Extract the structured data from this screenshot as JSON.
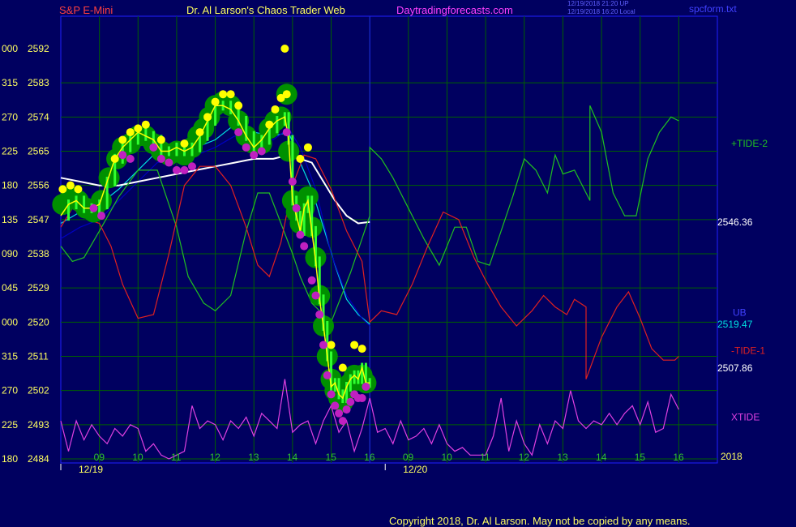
{
  "header": {
    "symbol": "S&P E-Mini",
    "author": "Dr. Al Larson's Chaos Trader Web",
    "site": "Daytradingforecasts.com",
    "stamp1": "12/19/2018 21:20 UP",
    "stamp2": "12/19/2018 16:20 Local",
    "filename": "spcform.txt"
  },
  "footer": {
    "copyright": "Copyright 2018, Dr. Al Larson. May not be copied by any means."
  },
  "colors": {
    "background": "#000060",
    "grid": "#006000",
    "frame": "#2020ff",
    "price": "#ffff00",
    "ub": "#00e0e0",
    "tide_plus": "#20c020",
    "tide_minus": "#e02020",
    "xtide": "#e040e0",
    "slow_avg": "#ffffff",
    "lb": "#0000c0",
    "ball_big": "#009000",
    "ball_yellow": "#ffff00",
    "ball_magenta": "#c020c0"
  },
  "chart_data": {
    "type": "line",
    "y_ticks": [
      {
        "left": "000",
        "value": "2592"
      },
      {
        "left": "315",
        "value": "2583"
      },
      {
        "left": "270",
        "value": "2574"
      },
      {
        "left": "225",
        "value": "2565"
      },
      {
        "left": "180",
        "value": "2556"
      },
      {
        "left": "135",
        "value": "2547"
      },
      {
        "left": "090",
        "value": "2538"
      },
      {
        "left": "045",
        "value": "2529"
      },
      {
        "left": "000",
        "value": "2520"
      },
      {
        "left": "315",
        "value": "2511"
      },
      {
        "left": "270",
        "value": "2502"
      },
      {
        "left": "225",
        "value": "2493"
      },
      {
        "left": "180",
        "value": "2484"
      }
    ],
    "ylim": [
      2484,
      2592
    ],
    "xlim": [
      8,
      25
    ],
    "x_ticks": [
      {
        "x": 9,
        "label": "09"
      },
      {
        "x": 10,
        "label": "10"
      },
      {
        "x": 11,
        "label": "11"
      },
      {
        "x": 12,
        "label": "12"
      },
      {
        "x": 13,
        "label": "13"
      },
      {
        "x": 14,
        "label": "14"
      },
      {
        "x": 15,
        "label": "15"
      },
      {
        "x": 16,
        "label": "16"
      },
      {
        "x": 17,
        "label": "09"
      },
      {
        "x": 18,
        "label": "10"
      },
      {
        "x": 19,
        "label": "11"
      },
      {
        "x": 20,
        "label": "12"
      },
      {
        "x": 21,
        "label": "13"
      },
      {
        "x": 22,
        "label": "14"
      },
      {
        "x": 23,
        "label": "15"
      },
      {
        "x": 24,
        "label": "16"
      }
    ],
    "date_labels": [
      {
        "x": 8,
        "label": "12/19"
      },
      {
        "x": 16.4,
        "label": "12/20"
      }
    ],
    "year_label": "2018",
    "day_divider_x": 16,
    "series": [
      {
        "name": "Price",
        "role": "price",
        "x": [
          8.0,
          8.2,
          8.4,
          8.6,
          8.8,
          9.0,
          9.2,
          9.4,
          9.6,
          9.8,
          10.0,
          10.2,
          10.4,
          10.6,
          10.8,
          11.0,
          11.2,
          11.4,
          11.6,
          11.8,
          12.0,
          12.2,
          12.4,
          12.6,
          12.8,
          13.0,
          13.2,
          13.4,
          13.6,
          13.8,
          13.9,
          14.0,
          14.1,
          14.2,
          14.3,
          14.4,
          14.5,
          14.6,
          14.7,
          14.8,
          14.9,
          15.0,
          15.1,
          15.2,
          15.3,
          15.4,
          15.5,
          15.6,
          15.7,
          15.8,
          15.9,
          16.0
        ],
        "y": [
          2548,
          2551,
          2552,
          2550,
          2550,
          2551,
          2557,
          2563,
          2566,
          2568,
          2570,
          2569,
          2568,
          2565,
          2565,
          2566,
          2565,
          2566,
          2569,
          2573,
          2577,
          2577,
          2576,
          2573,
          2569,
          2566,
          2568,
          2571,
          2573,
          2574,
          2568,
          2552,
          2548,
          2544,
          2550,
          2552,
          2544,
          2536,
          2526,
          2519,
          2511,
          2503,
          2504,
          2501,
          2500,
          2503,
          2505,
          2506,
          2505,
          2508,
          2504,
          2504
        ]
      },
      {
        "name": "UB",
        "role": "ub",
        "x": [
          8.0,
          8.5,
          9.0,
          9.5,
          10.0,
          10.5,
          11.0,
          11.5,
          12.0,
          12.5,
          13.0,
          13.5,
          13.9,
          14.2,
          14.5,
          14.8,
          15.1,
          15.4,
          15.7,
          16.0
        ],
        "y": [
          2546,
          2549,
          2551,
          2555,
          2560,
          2565,
          2565,
          2566,
          2568,
          2572,
          2570,
          2569,
          2570,
          2562,
          2555,
          2545,
          2535,
          2526,
          2522,
          2519.47
        ]
      },
      {
        "name": "LB",
        "role": "lb",
        "x": [
          8.0,
          8.5,
          9.0,
          9.5,
          10.0,
          10.5,
          11.0,
          11.5,
          12.0,
          12.5,
          13.0,
          13.5,
          13.9,
          14.2,
          14.6,
          15.0,
          15.4,
          15.8,
          16.0
        ],
        "y": [
          2542,
          2545,
          2547,
          2552,
          2557,
          2562,
          2563,
          2564,
          2566,
          2569,
          2568,
          2568,
          2571,
          2566,
          2555,
          2538,
          2527,
          2521,
          2519
        ]
      },
      {
        "name": "Slow average",
        "role": "slow",
        "x": [
          8.0,
          8.5,
          9.0,
          9.5,
          10.0,
          10.5,
          11.0,
          11.5,
          12.0,
          12.5,
          13.0,
          13.5,
          13.9,
          14.2,
          14.5,
          14.8,
          15.1,
          15.4,
          15.7,
          16.0
        ],
        "y": [
          2558,
          2557,
          2556,
          2556,
          2557,
          2558,
          2559,
          2560,
          2561,
          2562,
          2563,
          2563,
          2564,
          2563,
          2562,
          2557,
          2552,
          2548,
          2546,
          2546.36
        ]
      },
      {
        "name": "+TIDE-2",
        "role": "tide_plus",
        "x": [
          8.0,
          8.3,
          8.6,
          9.0,
          9.5,
          10.0,
          10.5,
          11.0,
          11.3,
          11.7,
          12.0,
          12.4,
          12.8,
          13.1,
          13.4,
          13.7,
          14.0,
          14.2,
          14.5,
          15.0,
          15.5,
          15.9,
          16.0,
          16.0,
          16.3,
          16.6,
          17.0,
          17.4,
          17.8,
          18.2,
          18.5,
          18.8,
          19.1,
          19.4,
          19.7,
          20.0,
          20.3,
          20.6,
          20.8,
          21.0,
          21.3,
          21.6,
          21.7,
          21.7,
          22.0,
          22.3,
          22.6,
          22.9,
          23.2,
          23.5,
          23.8,
          24.0
        ],
        "y": [
          2540,
          2536,
          2537,
          2544,
          2553,
          2560,
          2560,
          2545,
          2532,
          2525,
          2523,
          2527,
          2544,
          2554,
          2554,
          2546,
          2538,
          2532,
          2525,
          2520,
          2533,
          2545,
          2548,
          2566,
          2563,
          2558,
          2550,
          2542,
          2535,
          2545,
          2545,
          2536,
          2535,
          2544,
          2553,
          2563,
          2560,
          2554,
          2564,
          2559,
          2560,
          2554,
          2552,
          2577,
          2570,
          2554,
          2548,
          2548,
          2563,
          2570,
          2574,
          2573
        ]
      },
      {
        "name": "-TIDE-1",
        "role": "tide_minus",
        "x": [
          8.0,
          8.3,
          8.7,
          9.0,
          9.3,
          9.6,
          10.0,
          10.4,
          10.8,
          11.2,
          11.6,
          12.0,
          12.4,
          12.8,
          13.1,
          13.4,
          13.7,
          14.0,
          14.3,
          14.6,
          15.0,
          15.4,
          15.8,
          16.0,
          16.0,
          16.3,
          16.7,
          17.1,
          17.5,
          17.9,
          18.3,
          18.7,
          19.0,
          19.4,
          19.8,
          20.2,
          20.5,
          20.8,
          21.1,
          21.3,
          21.6,
          21.6,
          22.0,
          22.4,
          22.7,
          23.0,
          23.3,
          23.6,
          23.9,
          24.0
        ],
        "y": [
          2545,
          2550,
          2547,
          2546,
          2540,
          2530,
          2521,
          2522,
          2538,
          2556,
          2561,
          2561,
          2556,
          2545,
          2535,
          2532,
          2541,
          2556,
          2564,
          2563,
          2555,
          2544,
          2536,
          2520,
          2520,
          2523,
          2522,
          2530,
          2540,
          2549,
          2547,
          2537,
          2531,
          2524,
          2519,
          2523,
          2527,
          2524,
          2522,
          2526,
          2524,
          2505,
          2516,
          2524,
          2528,
          2521,
          2513,
          2510,
          2510,
          2511
        ]
      },
      {
        "name": "XTIDE",
        "role": "xtide",
        "x": [
          8.0,
          8.2,
          8.4,
          8.6,
          8.8,
          9.0,
          9.2,
          9.4,
          9.6,
          9.8,
          10.0,
          10.2,
          10.4,
          10.6,
          10.8,
          11.0,
          11.2,
          11.4,
          11.6,
          11.8,
          12.0,
          12.2,
          12.4,
          12.6,
          12.8,
          13.0,
          13.2,
          13.4,
          13.6,
          13.8,
          14.0,
          14.2,
          14.4,
          14.6,
          14.8,
          15.0,
          15.2,
          15.4,
          15.6,
          15.8,
          16.0,
          16.2,
          16.4,
          16.6,
          16.8,
          17.0,
          17.2,
          17.4,
          17.6,
          17.8,
          18.0,
          18.2,
          18.4,
          18.6,
          18.8,
          19.0,
          19.2,
          19.4,
          19.6,
          19.8,
          20.0,
          20.2,
          20.4,
          20.6,
          20.8,
          21.0,
          21.2,
          21.4,
          21.6,
          21.8,
          22.0,
          22.2,
          22.4,
          22.6,
          22.8,
          23.0,
          23.2,
          23.4,
          23.6,
          23.8,
          24.0
        ],
        "y": [
          2494,
          2486,
          2494,
          2489,
          2493,
          2490,
          2488,
          2492,
          2490,
          2493,
          2492,
          2486,
          2488,
          2485,
          2484,
          2485,
          2486,
          2498,
          2492,
          2494,
          2493,
          2489,
          2494,
          2492,
          2495,
          2490,
          2496,
          2494,
          2492,
          2505,
          2491,
          2493,
          2494,
          2488,
          2494,
          2498,
          2491,
          2494,
          2486,
          2492,
          2500,
          2491,
          2492,
          2488,
          2494,
          2489,
          2490,
          2492,
          2488,
          2493,
          2488,
          2486,
          2487,
          2485,
          2485,
          2485,
          2490,
          2500,
          2486,
          2494,
          2488,
          2485,
          2493,
          2488,
          2494,
          2492,
          2502,
          2494,
          2492,
          2494,
          2493,
          2496,
          2493,
          2496,
          2498,
          2493,
          2499,
          2491,
          2492,
          2501,
          2497
        ]
      }
    ],
    "balls": {
      "x": [
        8.05,
        8.25,
        8.45,
        8.65,
        8.85,
        9.05,
        9.25,
        9.45,
        9.6,
        9.8,
        10.0,
        10.2,
        10.4,
        10.6,
        10.8,
        11.0,
        11.2,
        11.4,
        11.55,
        11.7,
        11.85,
        12.0,
        12.2,
        12.4,
        12.6,
        12.8,
        13.0,
        13.2,
        13.4,
        13.55,
        13.7,
        13.85,
        13.9,
        14.0,
        14.1,
        14.2,
        14.3,
        14.4,
        14.5,
        14.6,
        14.7,
        14.8,
        14.9,
        15.0,
        15.1,
        15.2,
        15.3,
        15.4,
        15.5,
        15.6,
        15.7,
        15.8,
        15.9
      ],
      "y": [
        2551,
        2553,
        2552,
        2550,
        2549,
        2552,
        2558,
        2563,
        2566,
        2567,
        2569,
        2569,
        2567,
        2565,
        2564,
        2565,
        2564,
        2566,
        2569,
        2571,
        2574,
        2577,
        2578,
        2577,
        2573,
        2569,
        2567,
        2567,
        2571,
        2573,
        2574,
        2580,
        2565,
        2552,
        2549,
        2546,
        2550,
        2553,
        2545,
        2537,
        2527,
        2519,
        2511,
        2505,
        2502,
        2500,
        2499,
        2502,
        2504,
        2506,
        2505,
        2506,
        2504
      ]
    },
    "yellow_dots": {
      "x": [
        8.05,
        8.25,
        8.45,
        9.4,
        9.6,
        9.8,
        10.0,
        10.2,
        10.6,
        11.2,
        11.6,
        11.8,
        12.0,
        12.2,
        12.4,
        12.6,
        13.4,
        13.55,
        13.7,
        13.8,
        13.85,
        14.2,
        14.4,
        15.0,
        15.3,
        15.6,
        15.8
      ],
      "y": [
        2555,
        2556,
        2555,
        2563,
        2568,
        2570,
        2571,
        2572,
        2568,
        2567,
        2570,
        2574,
        2578,
        2580,
        2580,
        2577,
        2572,
        2576,
        2579,
        2592,
        2580,
        2563,
        2566,
        2514,
        2508,
        2514,
        2513
      ]
    },
    "magenta_dots": {
      "x": [
        8.85,
        9.05,
        9.6,
        9.8,
        10.4,
        10.6,
        10.8,
        11.0,
        11.2,
        11.4,
        12.6,
        12.8,
        13.0,
        13.2,
        13.85,
        14.0,
        14.1,
        14.2,
        14.3,
        14.5,
        14.6,
        14.7,
        14.8,
        14.9,
        15.0,
        15.1,
        15.2,
        15.3,
        15.4,
        15.5,
        15.6,
        15.7,
        15.8,
        15.9
      ],
      "y": [
        2550,
        2548,
        2564,
        2563,
        2566,
        2563,
        2562,
        2560,
        2560,
        2561,
        2570,
        2566,
        2564,
        2565,
        2570,
        2557,
        2550,
        2543,
        2540,
        2531,
        2527,
        2522,
        2514,
        2506,
        2501,
        2498,
        2496,
        2494,
        2497,
        2499,
        2501,
        2500,
        2500,
        2503
      ]
    },
    "right_labels": [
      {
        "text": "+TIDE-2",
        "y": 2567,
        "role": "tide_plus"
      },
      {
        "text": "2546.36",
        "y": 2546.36,
        "role": "white"
      },
      {
        "text": "UB",
        "y": 2522.5,
        "role": "ub_label"
      },
      {
        "text": "2519.47",
        "y": 2519.47,
        "role": "ub"
      },
      {
        "text": "-TIDE-1",
        "y": 2512.5,
        "role": "tide_minus"
      },
      {
        "text": "2507.86",
        "y": 2507.86,
        "role": "white"
      },
      {
        "text": "XTIDE",
        "y": 2495,
        "role": "xtide"
      }
    ]
  }
}
